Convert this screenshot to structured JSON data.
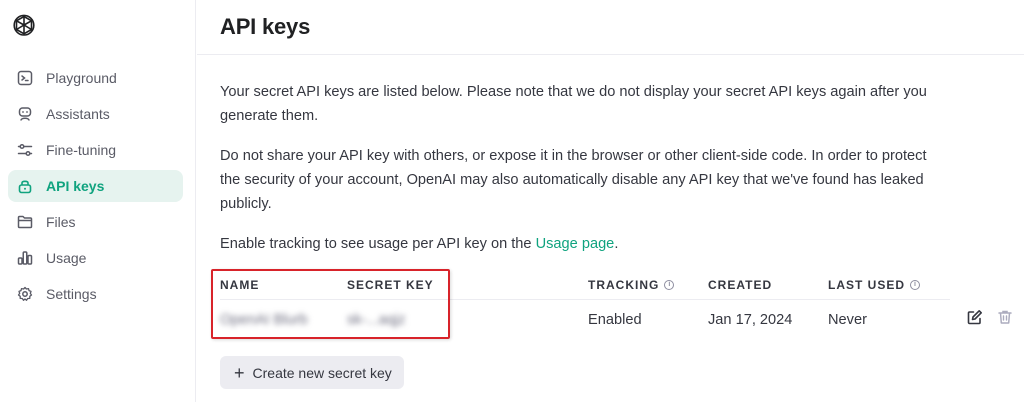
{
  "sidebar": {
    "items": [
      {
        "label": "Playground",
        "icon": "terminal-icon",
        "active": false
      },
      {
        "label": "Assistants",
        "icon": "robot-icon",
        "active": false
      },
      {
        "label": "Fine-tuning",
        "icon": "sliders-icon",
        "active": false
      },
      {
        "label": "API keys",
        "icon": "lock-icon",
        "active": true
      },
      {
        "label": "Files",
        "icon": "folder-icon",
        "active": false
      },
      {
        "label": "Usage",
        "icon": "bar-chart-icon",
        "active": false
      },
      {
        "label": "Settings",
        "icon": "gear-icon",
        "active": false
      }
    ]
  },
  "header": {
    "title": "API keys"
  },
  "intro": {
    "p1": "Your secret API keys are listed below. Please note that we do not display your secret API keys again after you generate them.",
    "p2": "Do not share your API key with others, or expose it in the browser or other client-side code. In order to protect the security of your account, OpenAI may also automatically disable any API key that we've found has leaked publicly.",
    "p3_prefix": "Enable tracking to see usage per API key on the ",
    "p3_link": "Usage page",
    "p3_suffix": "."
  },
  "table": {
    "headers": {
      "name": "NAME",
      "secret_key": "SECRET KEY",
      "tracking": "TRACKING",
      "created": "CREATED",
      "last_used": "LAST USED"
    },
    "rows": [
      {
        "name": "OpenAI Blurb",
        "secret_key": "sk-...aqjz",
        "tracking": "Enabled",
        "created": "Jan 17, 2024",
        "last_used": "Never"
      }
    ]
  },
  "create_button": {
    "label": "Create new secret key"
  },
  "colors": {
    "accent": "#10a37f",
    "active_bg": "#e6f3ef",
    "highlight": "#d8232a"
  }
}
